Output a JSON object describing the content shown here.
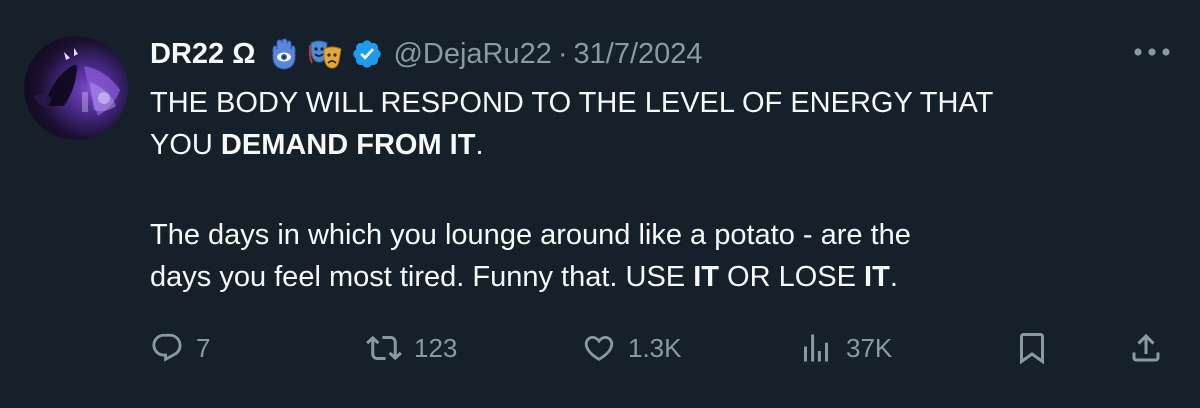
{
  "tweet": {
    "display_name": "DR22 Ω",
    "handle": "@DejaRu22",
    "separator": "·",
    "date": "31/7/2024",
    "line1": "THE BODY WILL RESPOND TO THE LEVEL OF ENERGY THAT",
    "line2_plain": "YOU ",
    "line2_bold": "DEMAND FROM IT",
    "line2_end": ".",
    "para2_line1": "The days in which you lounge around like a potato - are the",
    "para2_line2_a": "days you feel most tired. Funny that. USE ",
    "para2_line2_b": "IT",
    "para2_line2_c": " OR LOSE ",
    "para2_line2_d": "IT",
    "para2_line2_e": "."
  },
  "emojis": [
    "hamsa-emoji",
    "performing-arts-emoji"
  ],
  "actions": {
    "replies": "7",
    "reposts": "123",
    "likes": "1.3K",
    "views": "37K"
  },
  "icons": {
    "reply": "reply-icon",
    "repost": "repost-icon",
    "like": "heart-icon",
    "views": "views-icon",
    "bookmark": "bookmark-icon",
    "share": "share-icon",
    "more": "more-icon",
    "verified": "verified-badge-icon"
  },
  "colors": {
    "background": "#15202b",
    "text": "#f7f9f9",
    "secondary": "#8b98a5",
    "verified": "#1d9bf0"
  }
}
